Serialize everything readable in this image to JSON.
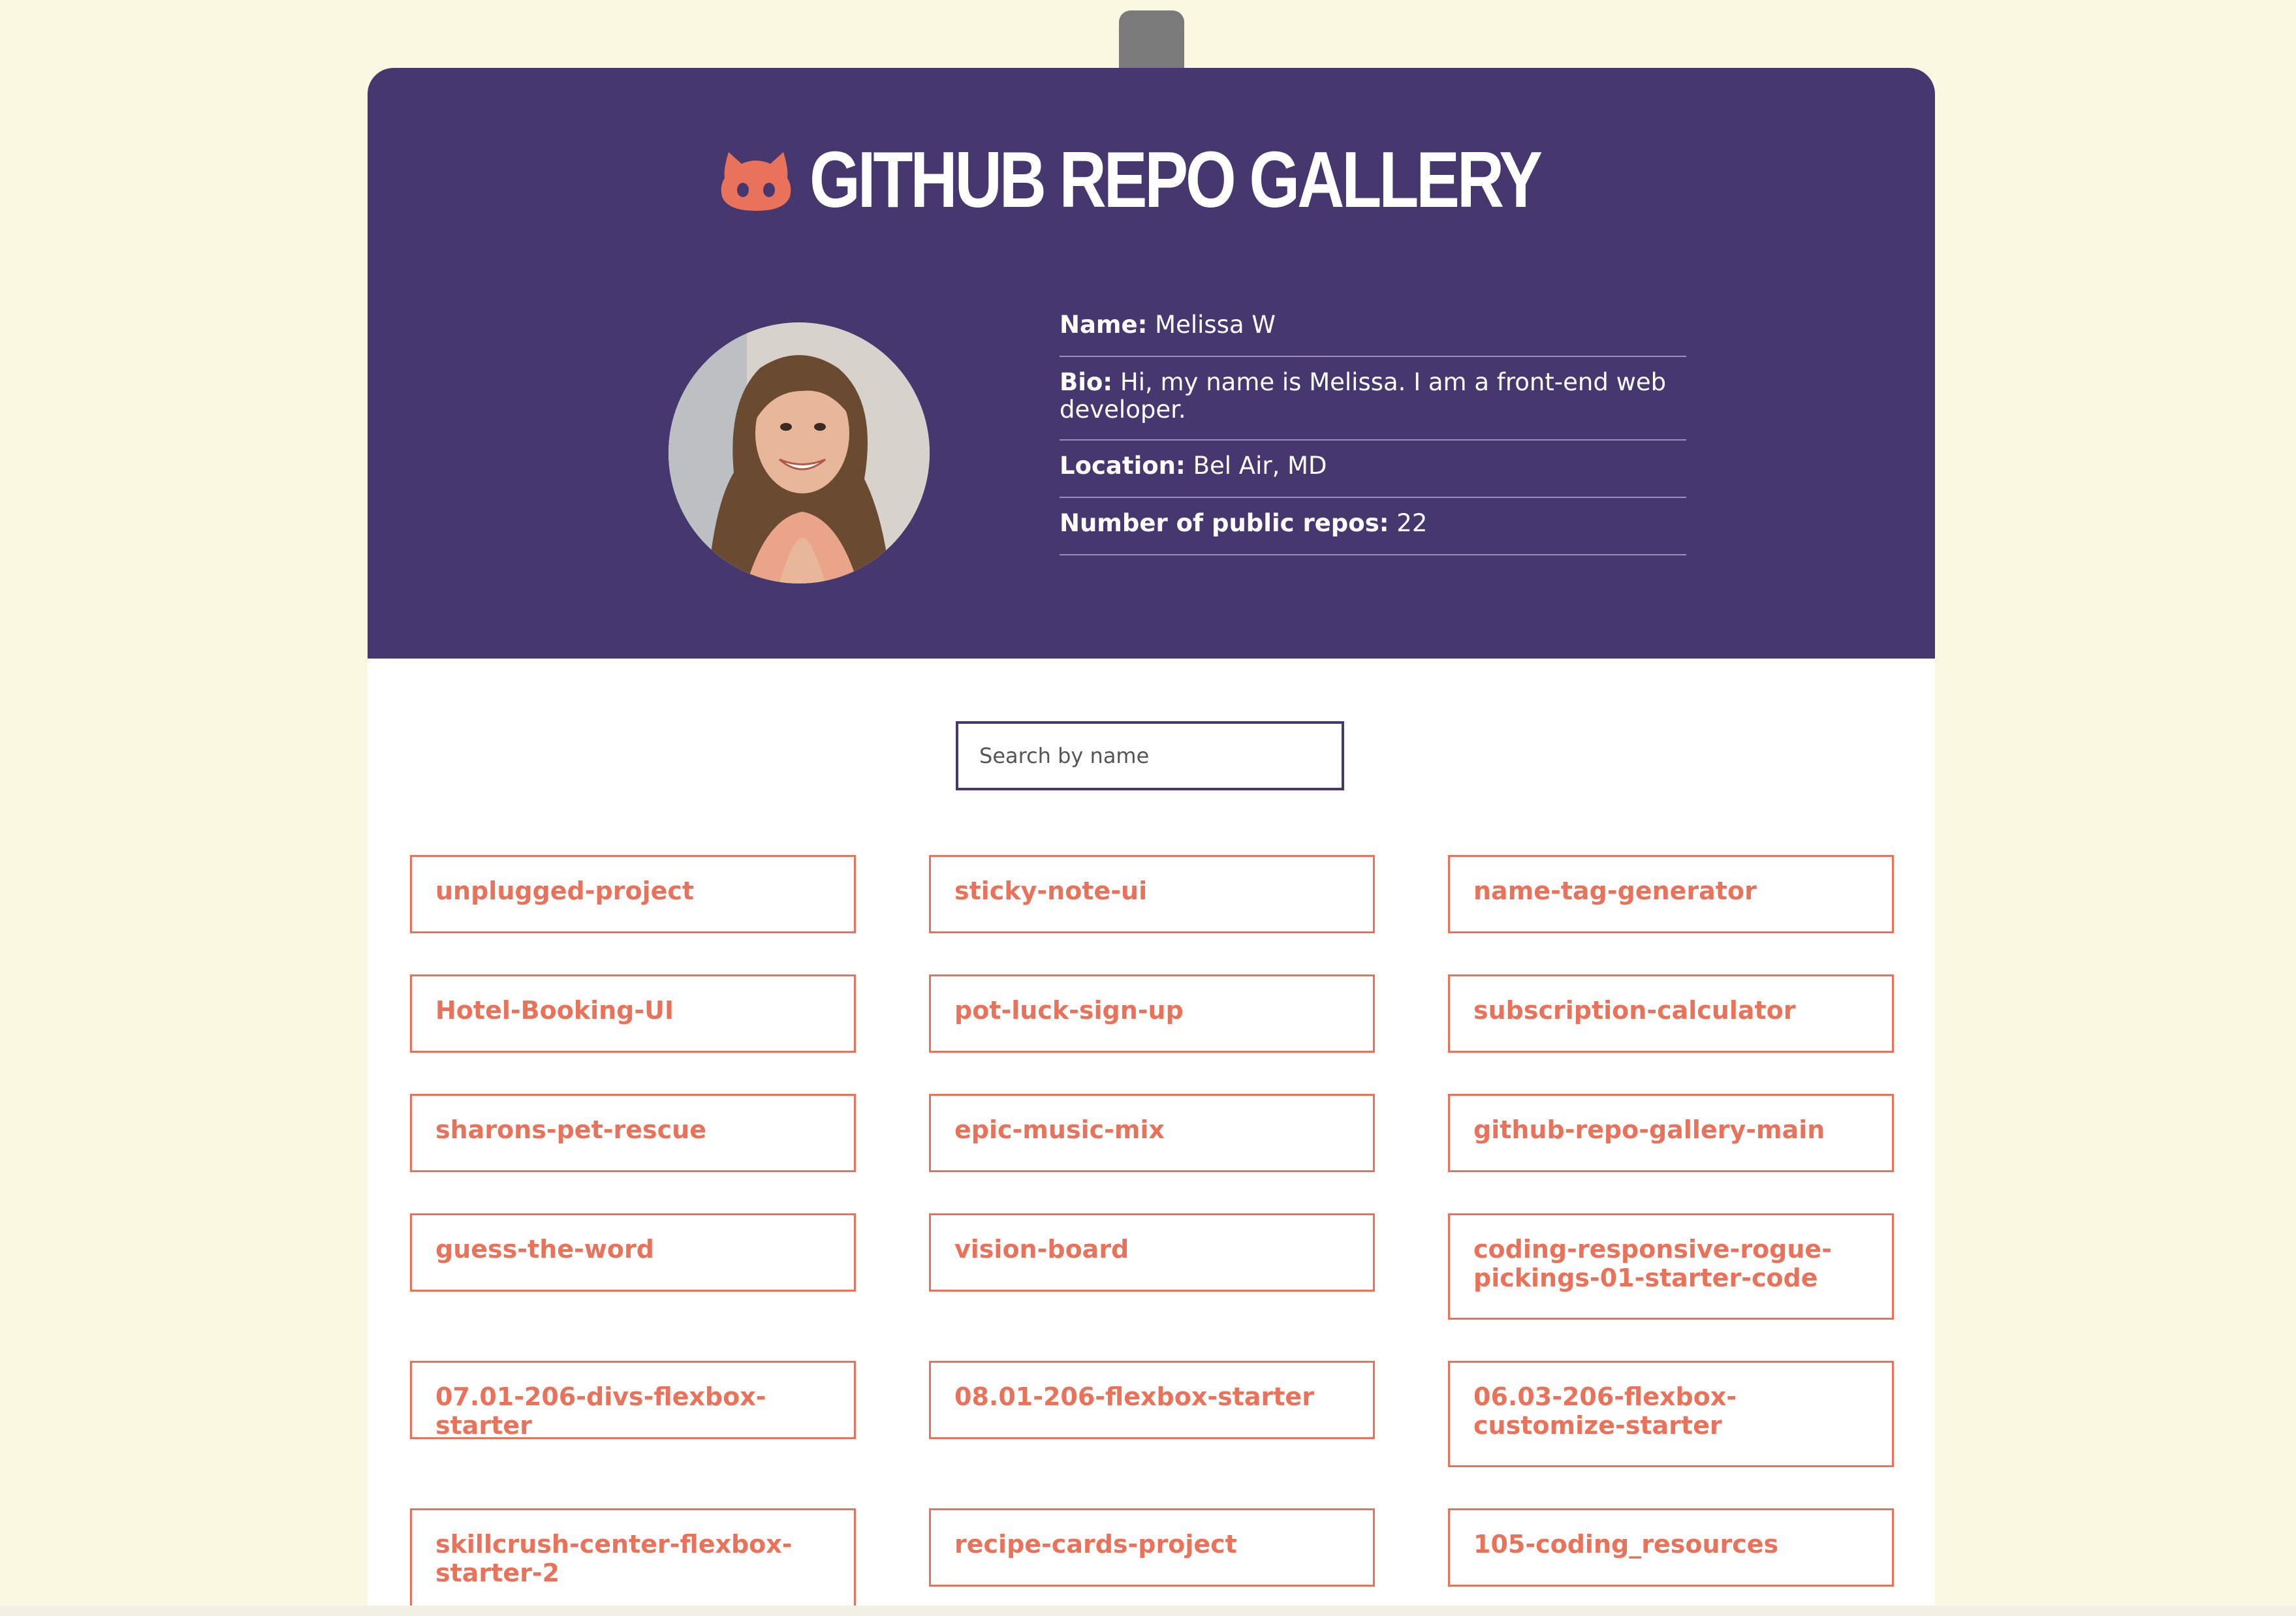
{
  "app": {
    "title": "GITHUB REPO GALLERY",
    "icon": "octocat-icon",
    "accent": "#e8735a",
    "header_bg": "#46386f",
    "page_bg": "#fbf8e1"
  },
  "profile": {
    "name_label": "Name:",
    "name": "Melissa W",
    "bio_label": "Bio:",
    "bio": "Hi, my name is Melissa. I am a front-end web developer.",
    "location_label": "Location:",
    "location": "Bel Air, MD",
    "repos_label": "Number of public repos:",
    "repos": "22"
  },
  "search": {
    "placeholder": "Search by name",
    "value": ""
  },
  "repos": [
    "unplugged-project",
    "sticky-note-ui",
    "name-tag-generator",
    "Hotel-Booking-UI",
    "pot-luck-sign-up",
    "subscription-calculator",
    "sharons-pet-rescue",
    "epic-music-mix",
    "github-repo-gallery-main",
    "guess-the-word",
    "vision-board",
    "coding-responsive-rogue-pickings-01-starter-code",
    "07.01-206-divs-flexbox-starter",
    "08.01-206-flexbox-starter",
    "06.03-206-flexbox-customize-starter",
    "skillcrush-center-flexbox-starter-2",
    "recipe-cards-project",
    "105-coding_resources"
  ]
}
